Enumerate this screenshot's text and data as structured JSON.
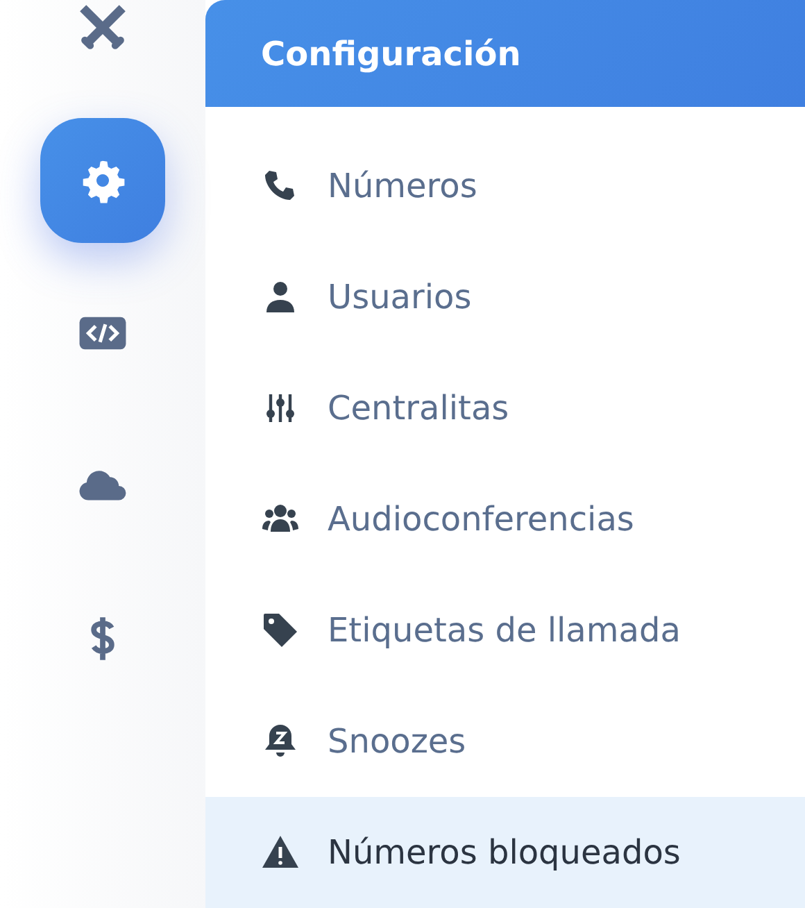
{
  "rail": [
    {
      "selected": false
    },
    {
      "selected": true
    },
    {
      "selected": false
    },
    {
      "selected": false
    },
    {
      "selected": false
    }
  ],
  "panel": {
    "title": "Configuración",
    "items": [
      {
        "label": "Números",
        "selected": false
      },
      {
        "label": "Usuarios",
        "selected": false
      },
      {
        "label": "Centralitas",
        "selected": false
      },
      {
        "label": "Audioconferencias",
        "selected": false
      },
      {
        "label": "Etiquetas de llamada",
        "selected": false
      },
      {
        "label": "Snoozes",
        "selected": false
      },
      {
        "label": "Números bloqueados",
        "selected": true
      }
    ]
  }
}
